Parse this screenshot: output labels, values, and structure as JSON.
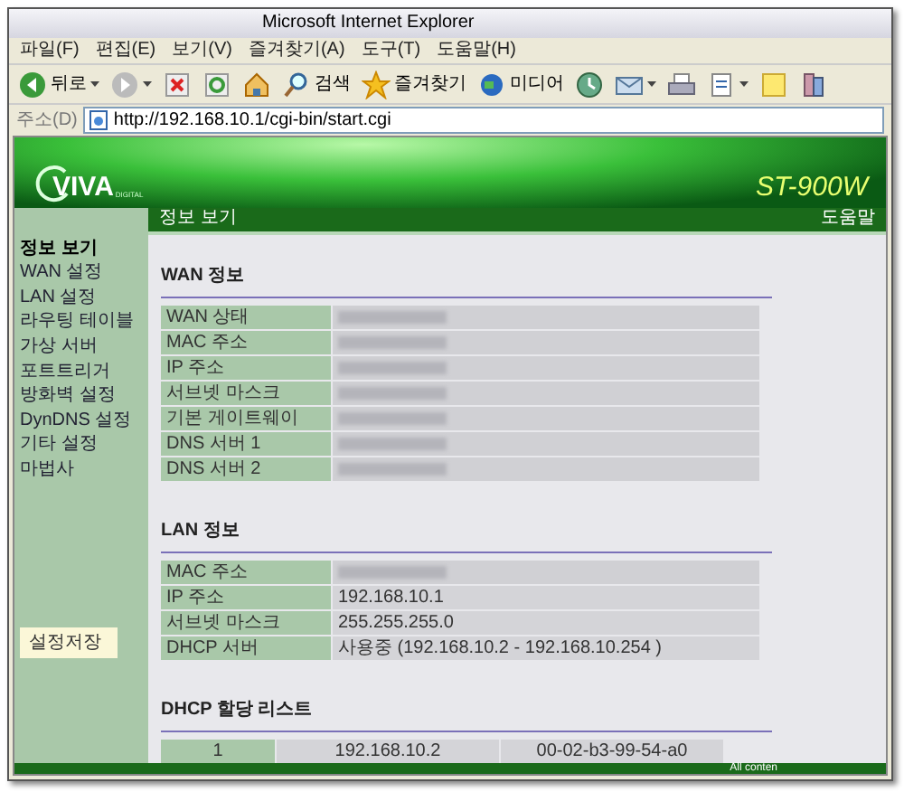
{
  "window": {
    "title": "Microsoft Internet Explorer"
  },
  "menu_bar": [
    "파일(F)",
    "편집(E)",
    "보기(V)",
    "즐겨찾기(A)",
    "도구(T)",
    "도움말(H)"
  ],
  "toolbar": [
    {
      "kind": "back",
      "label": "뒤로",
      "menu": true
    },
    {
      "kind": "forward",
      "menu": true
    },
    {
      "kind": "stop",
      "menu": false
    },
    {
      "kind": "refresh",
      "menu": false
    },
    {
      "kind": "home",
      "menu": false
    },
    {
      "kind": "search",
      "label": "검색",
      "menu": false
    },
    {
      "kind": "favorites",
      "label": "즐겨찾기",
      "menu": false
    },
    {
      "kind": "media",
      "label": "미디어",
      "menu": false
    },
    {
      "kind": "history",
      "menu": false
    },
    {
      "kind": "mail",
      "menu": true
    },
    {
      "kind": "print",
      "menu": false
    },
    {
      "kind": "edit",
      "menu": true
    },
    {
      "kind": "note",
      "menu": false
    },
    {
      "kind": "messenger",
      "menu": false
    }
  ],
  "address_bar": {
    "label": "주소(D)",
    "url": "http://192.168.10.1/cgi-bin/start.cgi"
  },
  "banner": {
    "logo": "VIVA",
    "logo_sub": "DIGITAL",
    "model": "ST-900W"
  },
  "sidebar": {
    "items": [
      {
        "label": "정보 보기",
        "selected": true
      },
      {
        "label": "WAN 설정",
        "selected": false
      },
      {
        "label": "LAN 설정",
        "selected": false
      },
      {
        "label": "라우팅 테이블",
        "selected": false
      },
      {
        "label": "가상 서버",
        "selected": false
      },
      {
        "label": "포트트리거",
        "selected": false
      },
      {
        "label": "방화벽 설정",
        "selected": false
      },
      {
        "label": "DynDNS 설정",
        "selected": false
      },
      {
        "label": "기타 설정",
        "selected": false
      },
      {
        "label": "마법사",
        "selected": false
      }
    ],
    "save_button": "설정저장"
  },
  "header_bar": {
    "title": "정보 보기",
    "help": "도움말"
  },
  "sections": [
    {
      "title": "WAN 정보",
      "rows": [
        {
          "label": "WAN 상태",
          "redacted": true
        },
        {
          "label": "MAC 주소",
          "redacted": true
        },
        {
          "label": "IP 주소",
          "redacted": true
        },
        {
          "label": "서브넷 마스크",
          "redacted": true
        },
        {
          "label": "기본 게이트웨이",
          "redacted": true
        },
        {
          "label": "DNS 서버 1",
          "redacted": true
        },
        {
          "label": "DNS 서버 2",
          "redacted": true
        }
      ]
    },
    {
      "title": "LAN 정보",
      "rows": [
        {
          "label": "MAC 주소",
          "redacted": true
        },
        {
          "label": "IP 주소",
          "value": "192.168.10.1",
          "redacted": false
        },
        {
          "label": "서브넷 마스크",
          "value": "255.255.255.0",
          "redacted": false
        },
        {
          "label": "DHCP 서버",
          "value": "사용중 (192.168.10.2 - 192.168.10.254 )",
          "redacted": false
        }
      ]
    }
  ],
  "dhcp_list": {
    "title": "DHCP 할당 리스트",
    "rows": [
      {
        "cells": [
          "1",
          "192.168.10.2",
          "00-02-b3-99-54-a0"
        ]
      }
    ]
  },
  "footer": "All conten"
}
